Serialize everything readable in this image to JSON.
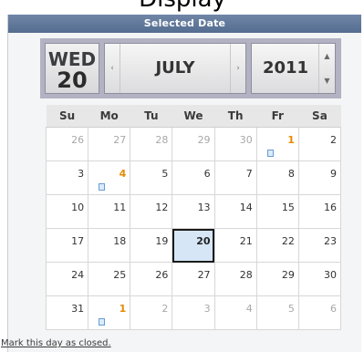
{
  "page_title": "Display",
  "panel": {
    "header": "Selected Date"
  },
  "date_bar": {
    "day_of_week": "WED",
    "day": "20",
    "month": "JULY",
    "year": "2011",
    "prev_month_arrow": "‹",
    "next_month_arrow": "›",
    "year_up_arrow": "▲",
    "year_down_arrow": "▼"
  },
  "calendar": {
    "weekdays": [
      "Su",
      "Mo",
      "Tu",
      "We",
      "Th",
      "Fr",
      "Sa"
    ],
    "weeks": [
      [
        {
          "d": "26",
          "other": true
        },
        {
          "d": "27",
          "other": true
        },
        {
          "d": "28",
          "other": true
        },
        {
          "d": "29",
          "other": true
        },
        {
          "d": "30",
          "other": true
        },
        {
          "d": "1",
          "event": true,
          "note": true
        },
        {
          "d": "2"
        }
      ],
      [
        {
          "d": "3"
        },
        {
          "d": "4",
          "event": true,
          "note": true
        },
        {
          "d": "5"
        },
        {
          "d": "6"
        },
        {
          "d": "7"
        },
        {
          "d": "8"
        },
        {
          "d": "9"
        }
      ],
      [
        {
          "d": "10"
        },
        {
          "d": "11"
        },
        {
          "d": "12"
        },
        {
          "d": "13"
        },
        {
          "d": "14"
        },
        {
          "d": "15"
        },
        {
          "d": "16"
        }
      ],
      [
        {
          "d": "17"
        },
        {
          "d": "18"
        },
        {
          "d": "19"
        },
        {
          "d": "20",
          "selected": true
        },
        {
          "d": "21"
        },
        {
          "d": "22"
        },
        {
          "d": "23"
        }
      ],
      [
        {
          "d": "24"
        },
        {
          "d": "25"
        },
        {
          "d": "26"
        },
        {
          "d": "27"
        },
        {
          "d": "28"
        },
        {
          "d": "29"
        },
        {
          "d": "30"
        }
      ],
      [
        {
          "d": "31"
        },
        {
          "d": "1",
          "other": true,
          "event": true,
          "note": true
        },
        {
          "d": "2",
          "other": true
        },
        {
          "d": "3",
          "other": true
        },
        {
          "d": "4",
          "other": true
        },
        {
          "d": "5",
          "other": true
        },
        {
          "d": "6",
          "other": true
        }
      ]
    ]
  },
  "footer": {
    "mark_closed_link": "Mark this day as closed."
  },
  "colors": {
    "header_bar": "#5c7497",
    "date_bar": "#b3b2c3",
    "event_day": "#e68a00",
    "selected_day": "#d6e6f7"
  },
  "icons": {
    "note": "note-icon"
  }
}
